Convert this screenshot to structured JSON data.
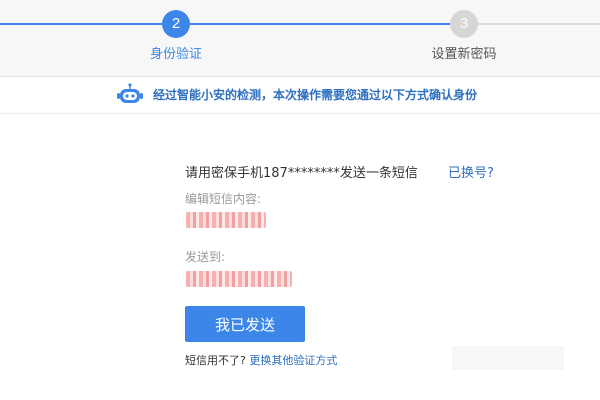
{
  "steps": [
    {
      "number": "2",
      "label": "身份验证",
      "active": true
    },
    {
      "number": "3",
      "label": "设置新密码",
      "active": false
    }
  ],
  "colors": {
    "accent": "#3b86e8",
    "inactive": "#d6d6d6",
    "link": "#2f6fc1",
    "step_active_label": "#3b86e8",
    "step_inactive_label": "#555555"
  },
  "notice": {
    "icon": "robot-icon",
    "text": "经过智能小安的检测，本次操作需要您通过以下方式确认身份"
  },
  "verify": {
    "instruction": "请用密保手机187********发送一条短信",
    "change_link": "已换号?",
    "sms_content_label": "编辑短信内容:",
    "send_to_label": "发送到:",
    "send_button": "我已发送",
    "help_prefix": "短信用不了?",
    "help_link": "更换其他验证方式"
  }
}
